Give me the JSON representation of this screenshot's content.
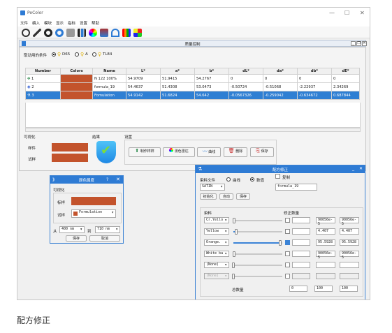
{
  "app": {
    "title": "PeColor"
  },
  "menu": [
    "文件",
    "编入",
    "模块",
    "显示",
    "指标",
    "设置",
    "帮助"
  ],
  "window": {
    "title": "质量控制"
  },
  "illuminant": {
    "label": "取动用的条件",
    "options": [
      "D65",
      "A",
      "TL84"
    ]
  },
  "table": {
    "headers": [
      "Number",
      "Colors",
      "Name",
      "L*",
      "a*",
      "b*",
      "dL*",
      "da*",
      "db*",
      "dE*"
    ],
    "rows": [
      {
        "num": "1",
        "name": "N 122 100%",
        "L": "54.9709",
        "a": "51.9415",
        "b": "54.2767",
        "dL": "0",
        "da": "0",
        "db": "0",
        "dE": "0"
      },
      {
        "num": "2",
        "name": "formula_19",
        "L": "54.4637",
        "a": "51.4308",
        "b": "53.0473",
        "dL": "-0.50724",
        "da": "-0.51068",
        "db": "-2.22937",
        "dE": "2.34269"
      },
      {
        "num": "3",
        "name": "Fomulation",
        "L": "54.9142",
        "a": "51.6824",
        "b": "54.642",
        "dL": "-0.0567326",
        "da": "-0.259042",
        "db": "-0.634672",
        "dE": "0.687844"
      }
    ]
  },
  "visual": {
    "title": "可视化",
    "sample_label": "样件",
    "trial_label": "试样"
  },
  "result": {
    "title": "结果"
  },
  "settings": {
    "title": "设置",
    "buttons": [
      "制作样样",
      "测色雷达",
      "曲线",
      "删除",
      "保存"
    ]
  },
  "color_dialog": {
    "title": "颜色属度",
    "help": "?",
    "section": "可视化",
    "sample_label": "标样",
    "trial_label": "试样",
    "trial_value": "Formulation",
    "from_label": "从",
    "from_value": "400 nm",
    "to_label": "到",
    "to_value": "710 nm",
    "ok": "保存",
    "cancel": "取消"
  },
  "formula_dialog": {
    "title": "配方修正",
    "file_label": "染料文件",
    "curve_label": "曲线",
    "value_label": "数值",
    "copy_label": "复制",
    "file_value": "SATIN",
    "formula_value": "formula_19",
    "init_btn": "初始化",
    "auto_btn": "自动",
    "save_btn": "保存",
    "dye_col": "染料",
    "corr_col": "修正数量",
    "dyes": [
      {
        "name": "Cr.Yello",
        "level": 0.02,
        "val1": "",
        "val2": "90056e-5",
        "val3": "90056e-5",
        "checked": false,
        "enabled": true
      },
      {
        "name": "Yellow",
        "level": 0.05,
        "val1": "",
        "val2": "4.407",
        "val3": "4.407",
        "checked": false,
        "enabled": true
      },
      {
        "name": "Orange.",
        "level": 0.96,
        "val1": "",
        "val2": "95.5928",
        "val3": "95.5928",
        "checked": true,
        "enabled": true
      },
      {
        "name": "White ba",
        "level": 0.02,
        "val1": "",
        "val2": "90056e-5",
        "val3": "90056e-5",
        "checked": false,
        "enabled": true
      },
      {
        "name": "(None)",
        "level": 0.0,
        "val1": "",
        "val2": "",
        "val3": "",
        "checked": false,
        "enabled": true
      },
      {
        "name": "(None)",
        "level": 0.0,
        "val1": "",
        "val2": "",
        "val3": "",
        "checked": false,
        "enabled": false
      }
    ],
    "total_label": "总数量",
    "total_vals": [
      "0",
      "100",
      "100"
    ]
  },
  "caption": "配方修正",
  "colors": {
    "sample": "#c3532c",
    "accent": "#2e7bd4"
  }
}
